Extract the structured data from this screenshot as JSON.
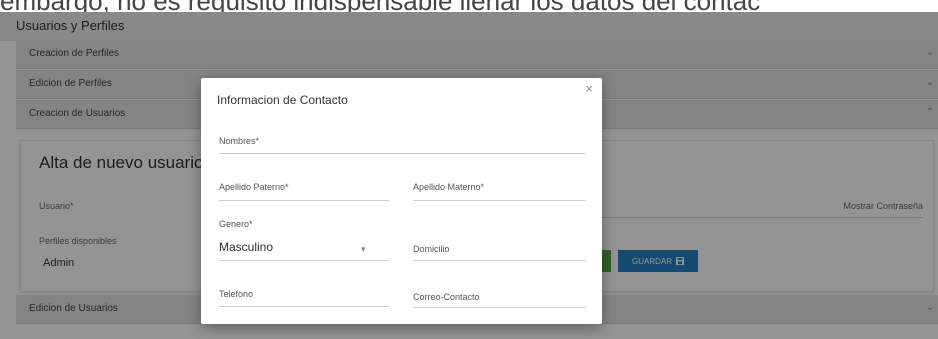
{
  "caption_text": "embargo, no es requisito indispensable llenar los datos del contac",
  "page_title": "Usuarios y Perfiles",
  "panels": [
    {
      "label": "Creacion de Perfiles",
      "expanded": false
    },
    {
      "label": "Edicion de Perfiles",
      "expanded": false
    },
    {
      "label": "Creacion de Usuarios",
      "expanded": true
    },
    {
      "label": "Edicion de Usuarios",
      "expanded": false
    }
  ],
  "card": {
    "title": "Alta de nuevo usuario",
    "usuario_label": "Usuario*",
    "mostrar_label": "Mostrar Contraseña",
    "perfiles_label": "Perfiles disponibles",
    "perfiles_item": "Admin",
    "guardar_label": "GUARDAR"
  },
  "modal": {
    "title": "Informacion de Contacto",
    "close": "×",
    "nombres_label": "Nombres*",
    "apellido_paterno_label": "Apellido Paterno*",
    "apellido_materno_label": "Apellido Materno*",
    "genero_label": "Genero*",
    "genero_value": "Masculino",
    "domicilio_label": "Domicilio",
    "telefono_label": "Telefono",
    "correo_label": "Correo-Contacto"
  },
  "colors": {
    "save_button": "#2581c4",
    "green_button": "#55a646",
    "panel_bg": "#e3e3e3"
  }
}
